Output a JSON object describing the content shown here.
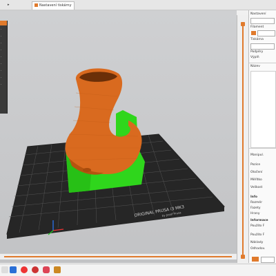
{
  "tabs": [
    {
      "label": "▸"
    },
    {
      "label": "Nastavení tiskárny"
    }
  ],
  "viewport": {
    "bed_text_line1": "ORIGINAL PRUSA i3 MK3",
    "bed_text_line2": "by Josef Prusa"
  },
  "vslider": {
    "top_label": "",
    "bottom_label": ""
  },
  "sidebar": {
    "lines": [
      "Nastavení",
      "Filament",
      "Tiskárna",
      "Podpěry",
      "Výplň",
      "Název",
      "Manipul.",
      "Pozice",
      "Otočení",
      "Měřítko",
      "Velikost",
      "Info",
      "Rozměr",
      "Fazety",
      "Hrany",
      "Informace",
      "Použito F",
      "Použito F",
      "Náklady",
      "Odhadov."
    ]
  },
  "hbar": {
    "label": ""
  },
  "colors": {
    "accent": "#e07a2c",
    "model_orange": "#d96a1f",
    "support_green": "#2fd61c",
    "bed": "#2f2f2f"
  }
}
